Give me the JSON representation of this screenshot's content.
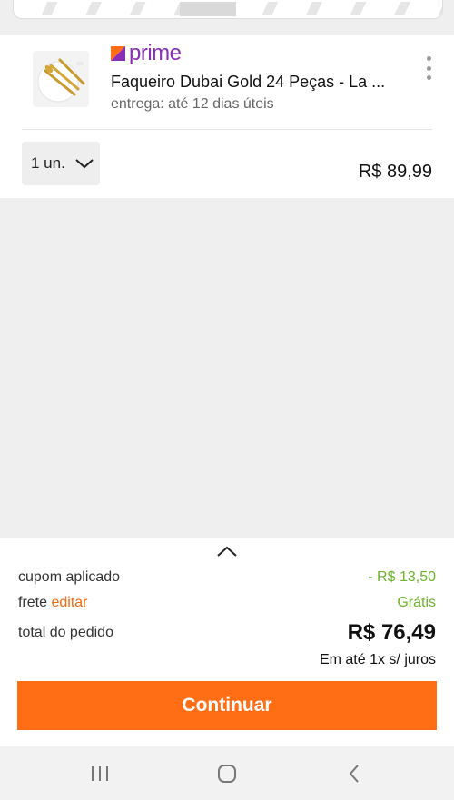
{
  "product": {
    "prime_label": "prime",
    "title": "Faqueiro Dubai Gold 24 Peças - La ...",
    "delivery": "entrega: até 12 dias úteis",
    "quantity": "1 un.",
    "price": "R$ 89,99"
  },
  "summary": {
    "coupon_label": "cupom aplicado",
    "coupon_value": "- R$ 13,50",
    "shipping_label": "frete",
    "shipping_edit": "editar",
    "shipping_value": "Grátis",
    "total_label": "total do pedido",
    "total_value": "R$ 76,49",
    "installments": "Em até 1x s/ juros",
    "continue_label": "Continuar"
  },
  "colors": {
    "accent": "#ff6e14",
    "prime": "#8a2fb5",
    "success": "#6cb52c"
  },
  "icons": [
    "prime-logo-icon",
    "more-options-icon",
    "chevron-down-icon",
    "chevron-up-icon",
    "recent-apps-icon",
    "home-icon",
    "back-icon"
  ]
}
